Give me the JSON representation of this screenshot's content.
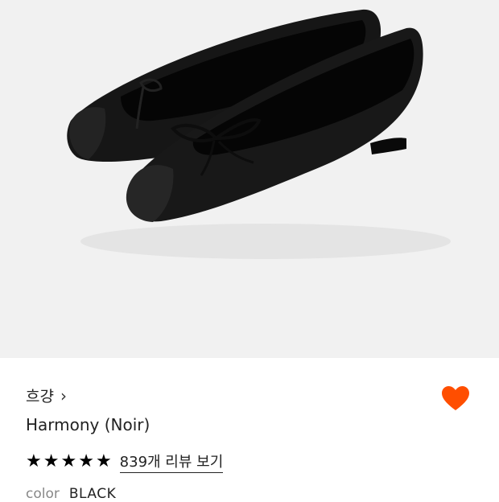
{
  "product": {
    "brand": "흐걍",
    "brand_chevron": "›",
    "name": "Harmony (Noir)",
    "rating_stars": 5,
    "review_link": "839개 리뷰 보기",
    "color_label": "color",
    "color_value": "BLACK",
    "wishlisted": true
  },
  "icons": {
    "heart": "heart-icon",
    "star": "star-icon",
    "chevron": "chevron-right-icon"
  },
  "colors": {
    "heart": "#ff4e00",
    "hero_bg": "#f1f1f1",
    "shoe": "#111111"
  }
}
